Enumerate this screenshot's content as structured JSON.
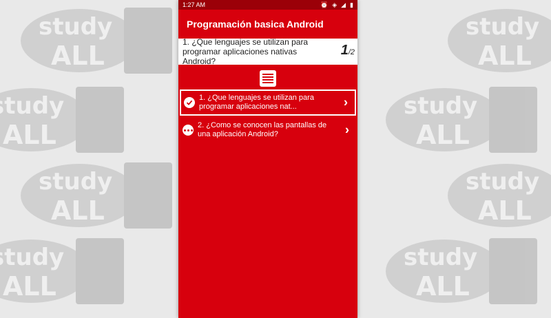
{
  "status_bar": {
    "time": "1:27 AM"
  },
  "app_bar": {
    "title": "Programación basica Android"
  },
  "question_header": {
    "text": "1. ¿Que lenguajes se utilizan para programar aplicaciones nativas Android?",
    "current": "1",
    "total": "/2"
  },
  "questions": [
    {
      "label": "1. ¿Que lenguajes se utilizan para programar aplicaciones nat...",
      "state": "answered",
      "icon": "check-circle-icon",
      "selected": true
    },
    {
      "label": "2. ¿Como se conocen las pantallas de una aplicación Android?",
      "state": "pending",
      "icon": "more-dots-icon",
      "selected": false
    }
  ],
  "watermark": {
    "word1": "study",
    "word2": "ALL",
    "book_text": "study ALL"
  },
  "colors": {
    "primary": "#d7000d",
    "status_bar": "#9b0008",
    "background": "#e9e9e9"
  }
}
